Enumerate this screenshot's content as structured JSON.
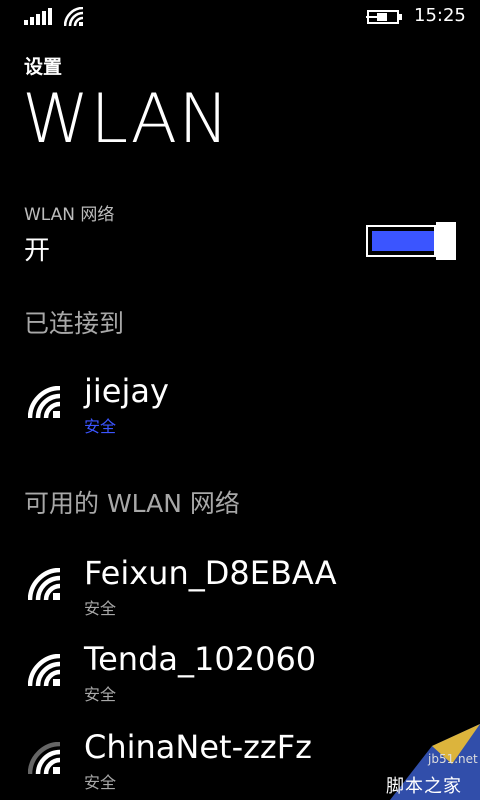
{
  "status_bar": {
    "time": "15:25",
    "icons": [
      "signal-strength-icon",
      "wifi-status-icon",
      "battery-charging-icon"
    ]
  },
  "header": {
    "app_title": "设置",
    "page_title": "WLAN"
  },
  "wlan": {
    "label": "WLAN 网络",
    "state": "开",
    "toggle_on": true,
    "accent_color": "#3b55ff"
  },
  "connected": {
    "heading": "已连接到",
    "networks": [
      {
        "name": "jiejay",
        "security": "安全"
      }
    ]
  },
  "available": {
    "heading": "可用的 WLAN 网络",
    "networks": [
      {
        "name": "Feixun_D8EBAA",
        "security": "安全"
      },
      {
        "name": "Tenda_102060",
        "security": "安全"
      },
      {
        "name": "ChinaNet-zzFz",
        "security": "安全"
      }
    ]
  },
  "watermark": {
    "url": "jb51.net",
    "text": "脚本之家"
  }
}
